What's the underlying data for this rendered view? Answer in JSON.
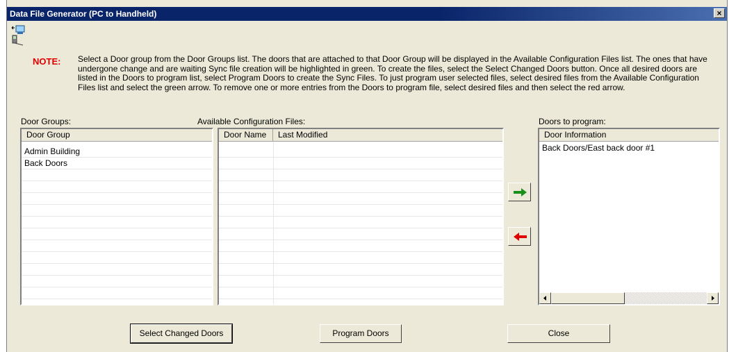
{
  "window": {
    "title": "Data File Generator (PC to Handheld)",
    "close_glyph": "×"
  },
  "note": {
    "label": "NOTE:",
    "text": "Select a Door group from the Door Groups list. The doors that are attached to that Door Group will be displayed in the Available Configuration Files list. The ones that have undergone change and are waiting Sync file creation will be highlighted in green. To create the files, select the Select Changed Doors button. Once all desired doors are listed in the Doors to program list, select Program Doors to create the Sync Files. To just program user selected files, select desired files from the Available Configuration Files list and select the green arrow. To remove one or more entries from the Doors to program file, select desired files and then select the red arrow."
  },
  "door_groups": {
    "label": "Door Groups:",
    "column": "Door Group",
    "items": [
      "Admin Building",
      "Back Doors"
    ]
  },
  "available": {
    "label": "Available Configuration Files:",
    "columns": [
      "Door Name",
      "Last Modified"
    ]
  },
  "program": {
    "label": "Doors to program:",
    "column": "Door Information",
    "items": [
      "Back Doors/East back door #1"
    ]
  },
  "buttons": {
    "select_changed": "Select Changed Doors",
    "program_doors": "Program Doors",
    "close": "Close"
  },
  "colors": {
    "add_arrow": "#1a8f1a",
    "remove_arrow": "#e00000",
    "note_label": "#e00000"
  },
  "icons": {
    "app": "pc-to-handheld-icon",
    "add": "green-right-arrow-icon",
    "remove": "red-left-arrow-icon"
  }
}
